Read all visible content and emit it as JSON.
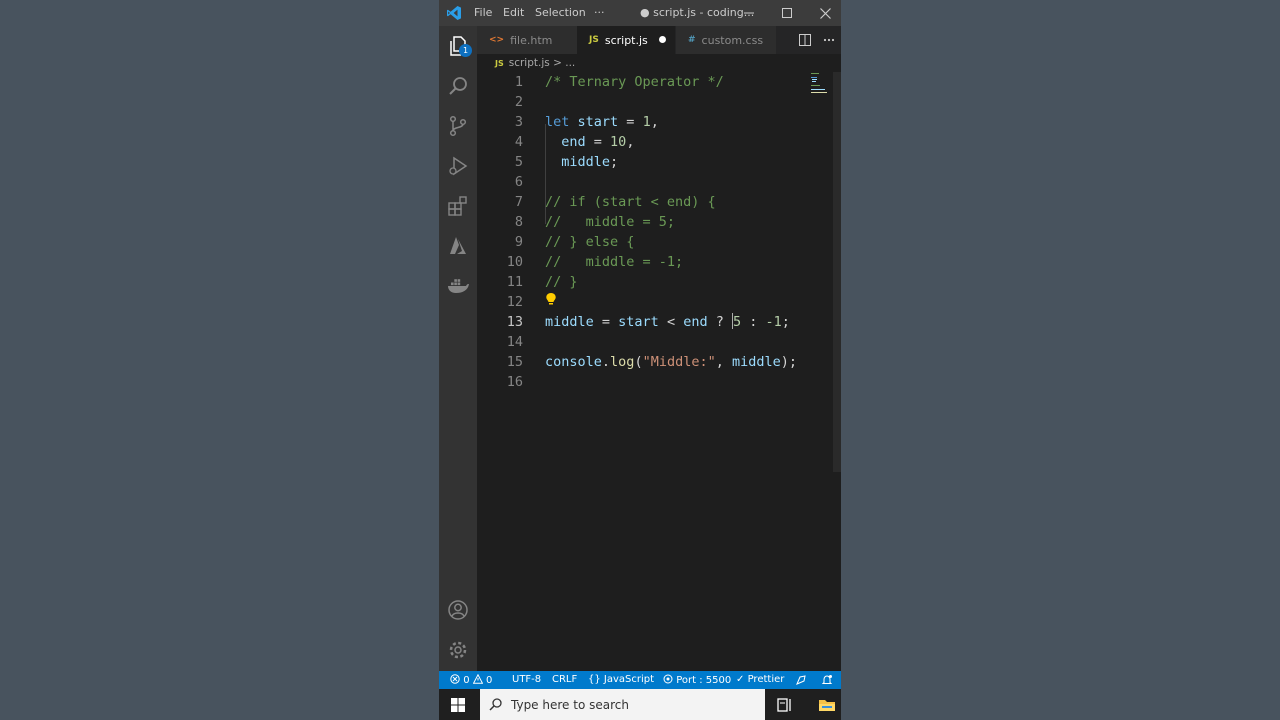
{
  "titlebar": {
    "menu": [
      "File",
      "Edit",
      "Selection",
      "···"
    ],
    "title": "● script.js - coding...",
    "buttons": [
      "minimize",
      "maximize",
      "close"
    ]
  },
  "activity_bar": {
    "explorer_badge": "1",
    "icons": [
      "explorer-icon",
      "search-icon",
      "source-control-icon",
      "run-debug-icon",
      "extensions-icon",
      "azure-icon",
      "docker-icon"
    ],
    "bottom_icons": [
      "account-icon",
      "settings-gear-icon"
    ]
  },
  "tabs": [
    {
      "label": "file.htm",
      "icon_glyph": "<>",
      "icon_color": "#e37933",
      "active": false
    },
    {
      "label": "script.js",
      "icon_glyph": "JS",
      "icon_color": "#cbcb41",
      "active": true,
      "modified": true
    },
    {
      "label": "custom.css",
      "icon_glyph": "#",
      "icon_color": "#519aba",
      "active": false
    }
  ],
  "breadcrumb": {
    "icon_glyph": "JS",
    "file": "script.js",
    "sep": ">",
    "rest": "..."
  },
  "editor": {
    "current_line": 13,
    "lines": [
      {
        "n": "1",
        "text": "/* Ternary Operator */"
      },
      {
        "n": "2",
        "text": ""
      },
      {
        "n": "3",
        "text": "let start = 1,"
      },
      {
        "n": "4",
        "text": "  end = 10,"
      },
      {
        "n": "5",
        "text": "  middle;"
      },
      {
        "n": "6",
        "text": ""
      },
      {
        "n": "7",
        "text": "// if (start < end) {"
      },
      {
        "n": "8",
        "text": "//   middle = 5;"
      },
      {
        "n": "9",
        "text": "// } else {"
      },
      {
        "n": "10",
        "text": "//   middle = -1;"
      },
      {
        "n": "11",
        "text": "// }"
      },
      {
        "n": "12",
        "text": ""
      },
      {
        "n": "13",
        "text": "middle = start < end ? 5 : -1;"
      },
      {
        "n": "14",
        "text": ""
      },
      {
        "n": "15",
        "text": "console.log(\"Middle:\", middle);"
      },
      {
        "n": "16",
        "text": ""
      }
    ],
    "tokens": {
      "l1": "/* Ternary Operator */",
      "l3_kw": "let",
      "l3_var": "start",
      "l3_op": " = ",
      "l3_num": "1",
      "l3_end": ",",
      "l4_var": "end",
      "l4_op": " = ",
      "l4_num": "10",
      "l4_end": ",",
      "l5_var": "middle",
      "l5_end": ";",
      "l7": "// if (start < end) {",
      "l8": "//   middle = 5;",
      "l9": "// } else {",
      "l10": "//   middle = -1;",
      "l11": "// }",
      "l13_a": "middle",
      "l13_b": " = ",
      "l13_c": "start",
      "l13_d": " < ",
      "l13_e": "end",
      "l13_f": " ? ",
      "l13_g": "5",
      "l13_h": " : ",
      "l13_i": "-1",
      "l13_j": ";",
      "l15_a": "console",
      "l15_b": ".",
      "l15_c": "log",
      "l15_d": "(",
      "l15_e": "\"Middle:\"",
      "l15_f": ", ",
      "l15_g": "middle",
      "l15_h": ");"
    }
  },
  "statusbar": {
    "errors": "0",
    "warnings": "0",
    "encoding": "UTF-8",
    "eol": "CRLF",
    "language": "JavaScript",
    "port": "Port : 5500",
    "prettier": "Prettier"
  },
  "taskbar": {
    "search_placeholder": "Type here to search"
  },
  "colors": {
    "statusbar": "#007acc",
    "editor_bg": "#1e1e1e",
    "comment": "#6a9955",
    "keyword": "#569cd6",
    "variable": "#9cdcfe",
    "number": "#b5cea8",
    "string": "#ce9178",
    "function": "#dcdcaa"
  }
}
